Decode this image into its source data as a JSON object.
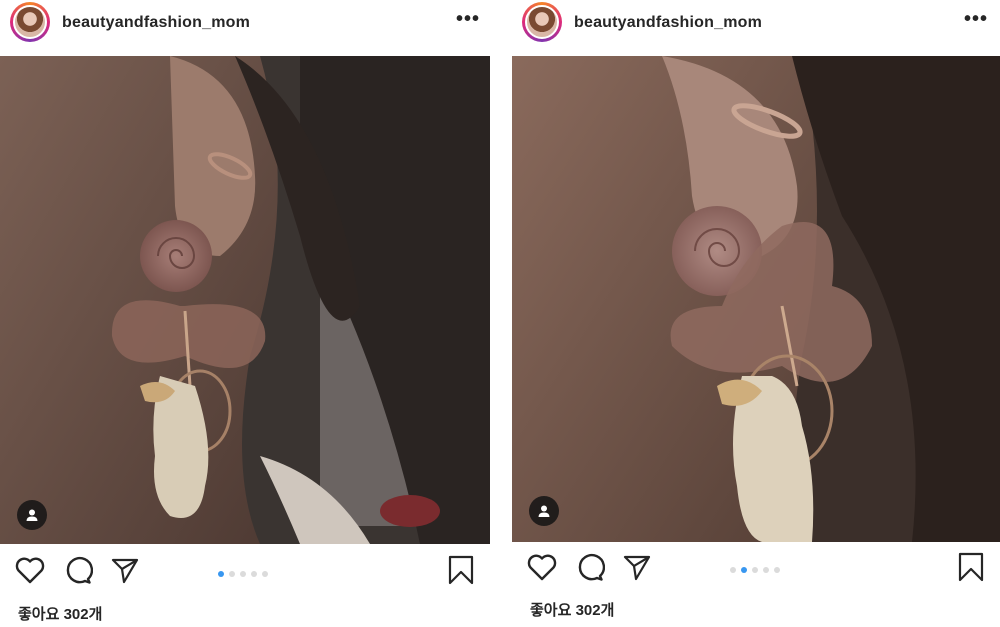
{
  "posts": [
    {
      "username": "beautyandfashion_mom",
      "more_label": "•••",
      "likes_label": "좋아요 302개",
      "carousel": {
        "count": 5,
        "active": 1
      },
      "icons": [
        "heart-icon",
        "comment-icon",
        "share-icon",
        "bookmark-icon",
        "user-tag-icon",
        "more-icon"
      ]
    },
    {
      "username": "beautyandfashion_mom",
      "more_label": "•••",
      "likes_label": "좋아요 302개",
      "carousel": {
        "count": 5,
        "active": 2
      },
      "icons": [
        "heart-icon",
        "comment-icon",
        "share-icon",
        "bookmark-icon",
        "user-tag-icon",
        "more-icon"
      ]
    }
  ],
  "colors": {
    "carousel_active": "#3897f0",
    "carousel_inactive": "#dbdbdb",
    "text": "#262626"
  }
}
